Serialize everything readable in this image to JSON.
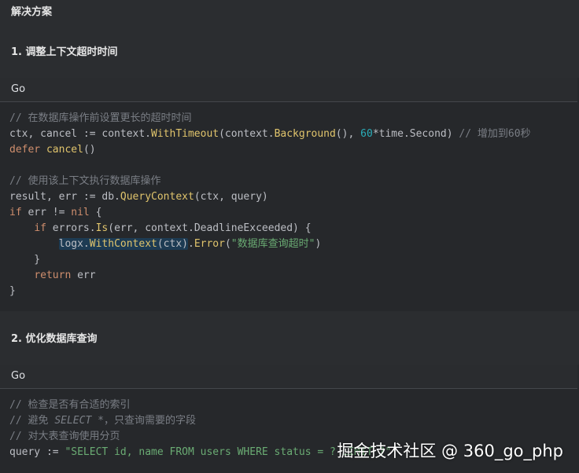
{
  "section_title": "解决方案",
  "step1": {
    "heading": "1. 调整上下文超时时间",
    "lang": "Go",
    "lines": {
      "l1": "// 在数据库操作前设置更长的超时时间",
      "l2a": "ctx, cancel := context.",
      "l2b": "WithTimeout",
      "l2c": "(context.",
      "l2d": "Background",
      "l2e": "(), ",
      "l2f": "60",
      "l2g": "*time.Second) ",
      "l2h": "// 增加到60秒",
      "l3a": "defer",
      "l3b": " ",
      "l3c": "cancel",
      "l3d": "()",
      "l5": "// 使用该上下文执行数据库操作",
      "l6a": "result, err := db.",
      "l6b": "QueryContext",
      "l6c": "(ctx, query)",
      "l7a": "if",
      "l7b": " err != ",
      "l7c": "nil",
      "l7d": " {",
      "l8a": "    ",
      "l8b": "if",
      "l8c": " errors.",
      "l8d": "Is",
      "l8e": "(err, context.DeadlineExceeded) {",
      "l9a": "        ",
      "l9b": "logx.",
      "l9c": "WithContext",
      "l9d": "(ctx)",
      "l9e": ".",
      "l9f": "Error",
      "l9g": "(",
      "l9h": "\"数据库查询超时\"",
      "l9i": ")",
      "l10": "    }",
      "l11a": "    ",
      "l11b": "return",
      "l11c": " err",
      "l12": "}"
    }
  },
  "step2": {
    "heading": "2. 优化数据库查询",
    "lang": "Go",
    "lines": {
      "l1": "// 检查是否有合适的索引",
      "l2a": "// 避免 ",
      "l2b": "SELECT *",
      "l2c": "，只查询需要的字段",
      "l3": "// 对大表查询使用分页",
      "l4a": "query := ",
      "l4b": "\"SELECT id, name FROM users WHERE status = ? LIMIT ?\""
    }
  },
  "watermark": "掘金技术社区 @ 360_go_php"
}
